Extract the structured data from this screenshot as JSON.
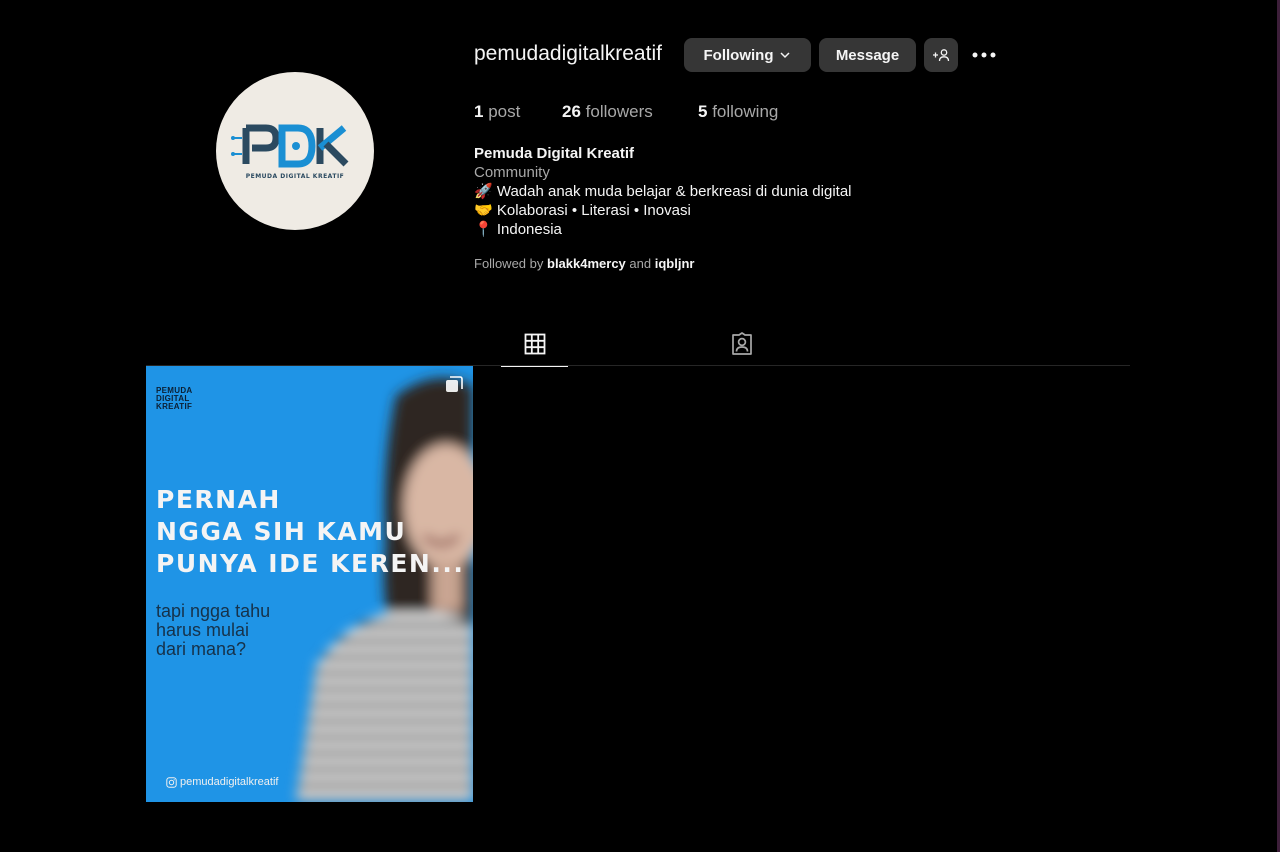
{
  "profile": {
    "username": "pemudadigitalkreatif",
    "avatar_text": "PEMUDA DIGITAL KREATIF",
    "buttons": {
      "following": "Following",
      "message": "Message"
    },
    "stats": {
      "posts_count": "1",
      "posts_label": "post",
      "followers_count": "26",
      "followers_label": "followers",
      "following_count": "5",
      "following_label": "following"
    },
    "bio": {
      "name": "Pemuda Digital Kreatif",
      "category": "Community",
      "line1": "🚀 Wadah anak muda belajar & berkreasi di dunia digital",
      "line2": "🤝 Kolaborasi • Literasi • Inovasi",
      "line3": "📍 Indonesia"
    },
    "followed_by": {
      "prefix": "Followed by",
      "user1": "blakk4mercy",
      "conjunction": "and",
      "user2": "iqbljnr"
    }
  },
  "tabs": [
    {
      "name": "posts",
      "icon": "grid-icon",
      "active": true
    },
    {
      "name": "tagged",
      "icon": "tagged-person-icon",
      "active": false
    }
  ],
  "posts": [
    {
      "brand": "PEMUDA\nDIGITAL\nKREATIF",
      "headline": "PERNAH\nNGGA SIH KAMU\nPUNYA IDE KEREN...",
      "subtext": "tapi ngga tahu\nharus mulai\ndari mana?",
      "handle": "pemudadigitalkreatif",
      "type_icon": "carousel-icon"
    }
  ],
  "colors": {
    "background": "#000000",
    "button": "#363636",
    "post_blue": "#1f94e6",
    "muted_text": "#a8a8a8"
  }
}
